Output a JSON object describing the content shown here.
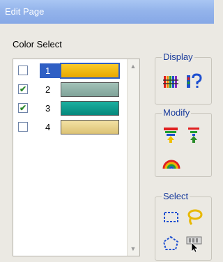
{
  "window": {
    "title": "Edit Page"
  },
  "color_select": {
    "label": "Color Select",
    "items": [
      {
        "number": "1",
        "checked": false,
        "selected": true,
        "color": "#f2b70c"
      },
      {
        "number": "2",
        "checked": true,
        "selected": false,
        "color": "#8fb1a7"
      },
      {
        "number": "3",
        "checked": true,
        "selected": false,
        "color": "#0f9c8f"
      },
      {
        "number": "4",
        "checked": false,
        "selected": false,
        "color": "#ead48a"
      }
    ],
    "check_mark": "✔"
  },
  "groups": {
    "display": {
      "label": "Display",
      "icons": [
        "color-bars-icon",
        "color-question-icon"
      ]
    },
    "modify": {
      "label": "Modify",
      "icons": [
        "color-merge-icon",
        "color-split-icon",
        "rainbow-icon"
      ]
    },
    "select": {
      "label": "Select",
      "icons": [
        "rectangle-select-icon",
        "lasso-select-icon",
        "polygon-select-icon",
        "pointer-select-icon"
      ]
    }
  }
}
